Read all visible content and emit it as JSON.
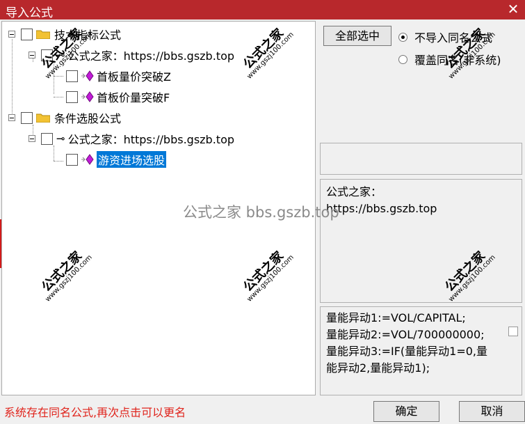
{
  "window": {
    "title": "导入公式",
    "close_glyph": "✕"
  },
  "tree": {
    "group1": {
      "label": "技术指标公式",
      "author": "公式之家：https://bbs.gszb.top",
      "items": [
        "首板量价突破Z",
        "首板价量突破F"
      ]
    },
    "group2": {
      "label": "条件选股公式",
      "author": "公式之家：https://bbs.gszb.top",
      "items": [
        "游资进场选股"
      ]
    }
  },
  "controls": {
    "select_all": "全部选中",
    "radio_skip": "不导入同名公式",
    "radio_overwrite": "覆盖同名(非系统)"
  },
  "info": {
    "line1": "公式之家：",
    "line2": "https://bbs.gszb.top"
  },
  "code": {
    "line1": "量能异动1:=VOL/CAPITAL;",
    "line2": "量能异动2:=VOL/700000000;",
    "line3": "量能异动3:=IF(量能异动1=0,量",
    "line4": "能异动2,量能异动1);"
  },
  "footer": {
    "status": "系统存在同名公式,再次点击可以更名",
    "ok": "确定",
    "cancel": "取消"
  },
  "watermark": {
    "title": "公式之家",
    "url": "www.gszj100.com",
    "center": "公式之家 bbs.gszb.top"
  }
}
